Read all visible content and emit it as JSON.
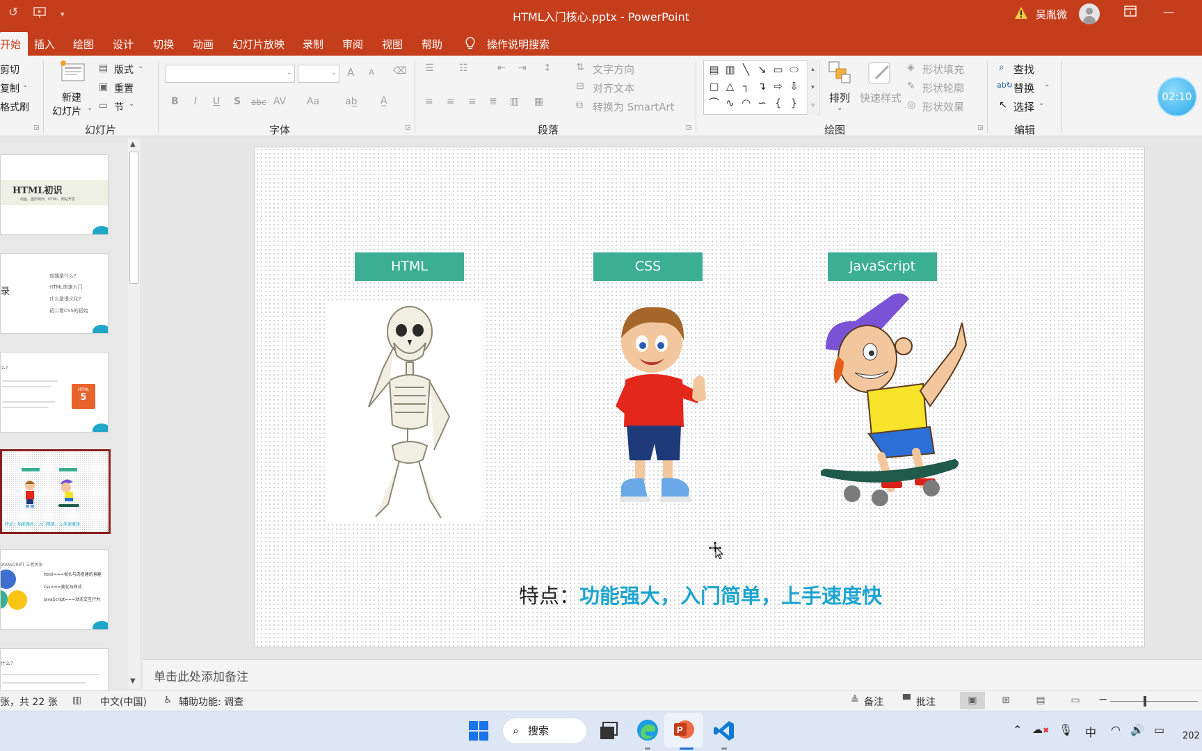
{
  "window": {
    "title": "HTML入门核心.pptx - PowerPoint",
    "user": "吴胤微"
  },
  "quick_access": {
    "undo_icon": "undo-icon",
    "present_icon": "present-from-start-icon",
    "customize": "▾"
  },
  "menu": {
    "tabs": [
      "开始",
      "插入",
      "绘图",
      "设计",
      "切换",
      "动画",
      "幻灯片放映",
      "录制",
      "审阅",
      "视图",
      "帮助"
    ],
    "tell_me": "操作说明搜索",
    "active": "开始"
  },
  "ribbon": {
    "clipboard": {
      "cut": "剪切",
      "copy": "复制",
      "format_painter": "格式刷"
    },
    "slides": {
      "new_slide_line1": "新建",
      "new_slide_line2": "幻灯片",
      "layout": "版式",
      "reset": "重置",
      "section": "节",
      "group": "幻灯片"
    },
    "font": {
      "group": "字体",
      "bold": "B",
      "italic": "I",
      "underline": "U",
      "shadow": "S",
      "strike": "abc",
      "spacing": "AV",
      "case": "Aa",
      "grow": "A",
      "shrink": "A"
    },
    "paragraph": {
      "group": "段落",
      "text_direction": "文字方向",
      "align_text": "对齐文本",
      "smartart": "转换为 SmartArt"
    },
    "drawing": {
      "group": "绘图",
      "arrange": "排列",
      "quick_styles": "快速样式",
      "shape_fill": "形状填充",
      "shape_outline": "形状轮廓",
      "shape_effects": "形状效果"
    },
    "editing": {
      "group": "编辑",
      "find": "查找",
      "replace": "替换",
      "select": "选择"
    }
  },
  "timer": "02:10",
  "thumbnails": [
    {
      "title": "HTML初识",
      "subtitle": "动画、图形制作、HTML、网站开发"
    },
    {
      "title": "录",
      "bullets": [
        "前端是什么?",
        "HTML快速入门",
        "什么是语义化?",
        "初二看CSS的初始"
      ]
    },
    {
      "title": "么?",
      "badge": "HTML"
    },
    {
      "tags": [
        "HTML",
        "CSS",
        "JavaScript"
      ],
      "caption": "特点：功能强大，入门简单，上手速度快"
    },
    {
      "title": "JAVASCRIPT 三者关系",
      "lines": [
        "html===骨头与肉搭建的身躯",
        "css===美化与样式",
        "JavaScript===动态交互行为"
      ]
    },
    {
      "title": "什么?"
    }
  ],
  "slide": {
    "tags": [
      "HTML",
      "CSS",
      "JavaScript"
    ],
    "feature_label": "特点：",
    "feature_text": "功能强大，入门简单，上手速度快",
    "colors": {
      "tag": "#3cae93",
      "highlight": "#1ea5cf"
    }
  },
  "notes_placeholder": "单击此处添加备注",
  "status": {
    "slide_count": "张，共 22 张",
    "language": "中文(中国)",
    "accessibility": "辅助功能: 调查",
    "notes": "备注",
    "comments": "批注"
  },
  "taskbar": {
    "search": "搜索",
    "ime": "中",
    "clock_partial": "202"
  }
}
